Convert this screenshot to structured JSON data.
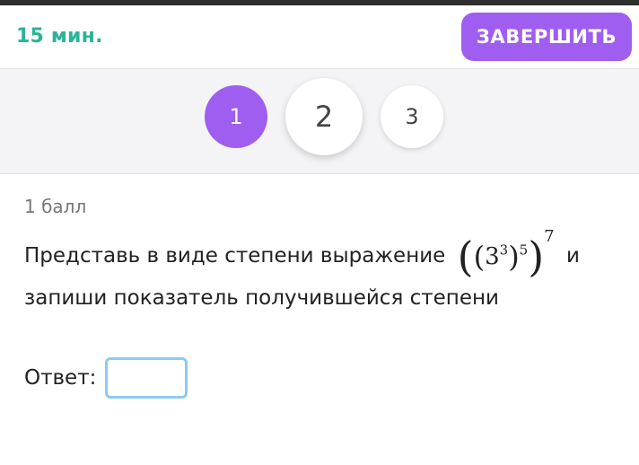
{
  "header": {
    "timer": "15 мин.",
    "finish_label": "ЗАВЕРШИТЬ",
    "accent_color": "#9f5ef0",
    "timer_color": "#2bb39a"
  },
  "navigation": {
    "questions": [
      {
        "label": "1",
        "state": "current"
      },
      {
        "label": "2",
        "state": "default"
      },
      {
        "label": "3",
        "state": "default"
      }
    ]
  },
  "question": {
    "points": "1 балл",
    "text_before": "Представь в виде степени выражение",
    "expression": {
      "base": "3",
      "exp_inner": "3",
      "exp_middle": "5",
      "exp_outer": "7"
    },
    "text_after": "и запиши показатель получившейся степени"
  },
  "answer": {
    "label": "Ответ:",
    "value": "",
    "placeholder": ""
  }
}
